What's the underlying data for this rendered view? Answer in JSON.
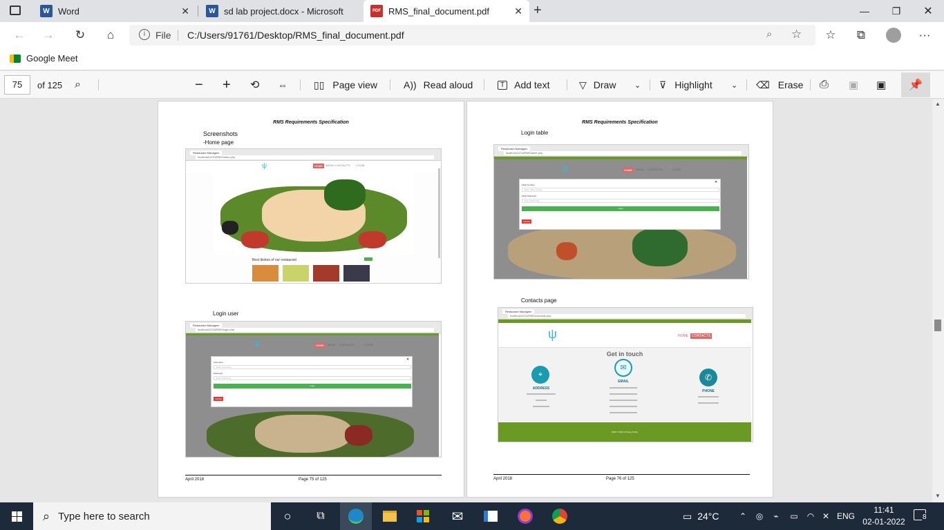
{
  "tabs": [
    {
      "label": "Word",
      "icon": "word-icon",
      "active": false
    },
    {
      "label": "sd lab project.docx - Microsoft W",
      "icon": "word-icon",
      "active": false
    },
    {
      "label": "RMS_final_document.pdf",
      "icon": "pdf-icon",
      "active": true
    }
  ],
  "address": {
    "scheme_label": "File",
    "url": "C:/Users/91761/Desktop/RMS_final_document.pdf"
  },
  "bookmarks": [
    {
      "label": "Google Meet"
    }
  ],
  "pdf_toolbar": {
    "page_number": "75",
    "page_total": "of 125",
    "page_view": "Page view",
    "read_aloud": "Read aloud",
    "add_text": "Add text",
    "draw": "Draw",
    "highlight": "Highlight",
    "erase": "Erase"
  },
  "pages": [
    {
      "header": "RMS Requirements Specification",
      "heading": "Screenshots",
      "sub1": "-Home page",
      "sub2": "Login user",
      "footer_left": "April 2018",
      "footer_center": "Page 75 of  125",
      "home_caption": "Best dishes of our restaurant"
    },
    {
      "header": "RMS Requirements Specification",
      "sub1": "Login table",
      "sub2": "Contacts page",
      "footer_left": "April 2018",
      "footer_center": "Page 76 of  125",
      "contact_title": "Get in touch",
      "address_label": "ADDRESS",
      "email_label": "EMAIL",
      "phone_label": "PHONE",
      "copyright": "RMS © 2018 | Privacy Policy"
    }
  ],
  "mini_nav": {
    "home": "HOME",
    "menu": "MENU",
    "contacts": "CONTACTS",
    "login": "LOGIN",
    "login_btn": "Login",
    "cancel": "Cancel",
    "username": "Username",
    "password": "Password",
    "enter_username": "Enter Username",
    "enter_password": "Enter Password",
    "table_number": "Table Number",
    "table_password": "Table Password",
    "enter_table_number": "Enter table number"
  },
  "taskbar": {
    "search_placeholder": "Type here to search",
    "weather": "24°C",
    "language": "ENG",
    "time": "11:41",
    "date": "02-01-2022",
    "notifications": "8"
  },
  "colors": {
    "accent_green": "#4caf50",
    "site_green": "#6a9a24",
    "nav_red": "#e06666",
    "teal": "#1a9bb0",
    "taskbar": "#1c2a3a"
  }
}
